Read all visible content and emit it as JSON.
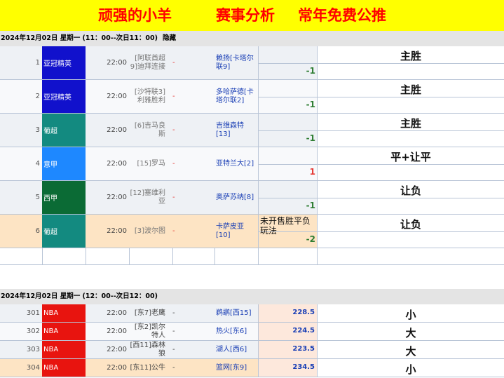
{
  "banner": {
    "part1": "顽强的小羊",
    "part2": "赛事分析",
    "part3": "常年免费公推"
  },
  "section1": {
    "title": "2024年12月02日 星期一 (11：00--次日11：00)",
    "hide_label": "隐藏"
  },
  "section2": {
    "title": "2024年12月02日 星期一 (12：00--次日12：00)"
  },
  "colors": {
    "banner_bg": "#ffff00",
    "banner_text": "#ff0000",
    "handicap_red": "#e53935",
    "handicap_green": "#2e7d32"
  },
  "matches": [
    {
      "num": "1",
      "league": "亚冠精英",
      "league_color": "#1111cc",
      "time": "22:00",
      "home": "[阿联酋超9]迪拜连接",
      "dash": "-",
      "away": "赖扬[卡塔尔联9]",
      "handicap": "-1",
      "handicap_color": "#2e7d32",
      "info": "",
      "pick": "主胜"
    },
    {
      "num": "2",
      "league": "亚冠精英",
      "league_color": "#1111cc",
      "time": "22:00",
      "home": "[沙特联3]利雅胜利",
      "dash": "-",
      "away": "多哈萨德[卡塔尔联2]",
      "handicap": "-1",
      "handicap_color": "#2e7d32",
      "info": "",
      "pick": "主胜"
    },
    {
      "num": "3",
      "league": "葡超",
      "league_color": "#138a80",
      "time": "22:00",
      "home": "[6]吉马良斯",
      "dash": "-",
      "away": "吉维森特[13]",
      "handicap": "-1",
      "handicap_color": "#2e7d32",
      "info": "",
      "pick": "主胜"
    },
    {
      "num": "4",
      "league": "意甲",
      "league_color": "#1e88ff",
      "time": "22:00",
      "home": "[15]罗马",
      "dash": "-",
      "away": "亚特兰大[2]",
      "handicap": "1",
      "handicap_color": "#e53935",
      "info": "",
      "pick": "平+让平"
    },
    {
      "num": "5",
      "league": "西甲",
      "league_color": "#0b6b35",
      "time": "22:00",
      "home": "[12]塞维利亚",
      "dash": "-",
      "away": "奥萨苏纳[8]",
      "handicap": "-1",
      "handicap_color": "#2e7d32",
      "info": "",
      "pick": "让负"
    },
    {
      "num": "6",
      "league": "葡超",
      "league_color": "#138a80",
      "time": "22:00",
      "home": "[3]波尔图",
      "dash": "-",
      "away": "卡萨皮亚[10]",
      "handicap": "-2",
      "handicap_color": "#2e7d32",
      "info": "未开售胜平负玩法",
      "pick": "让负"
    }
  ],
  "nba": [
    {
      "num": "301",
      "league": "NBA",
      "time": "22:00",
      "home": "[东7]老鹰",
      "dash": "-",
      "away": "鹈鹕[西15]",
      "total": "228.5",
      "pick": "小"
    },
    {
      "num": "302",
      "league": "NBA",
      "time": "22:00",
      "home": "[东2]凯尔特人",
      "dash": "-",
      "away": "热火[东6]",
      "total": "224.5",
      "pick": "大"
    },
    {
      "num": "303",
      "league": "NBA",
      "time": "22:00",
      "home": "[西11]森林狼",
      "dash": "-",
      "away": "湖人[西6]",
      "total": "223.5",
      "pick": "大"
    },
    {
      "num": "304",
      "league": "NBA",
      "time": "22:00",
      "home": "[东11]公牛",
      "dash": "-",
      "away": "篮网[东9]",
      "total": "234.5",
      "pick": "小"
    }
  ]
}
